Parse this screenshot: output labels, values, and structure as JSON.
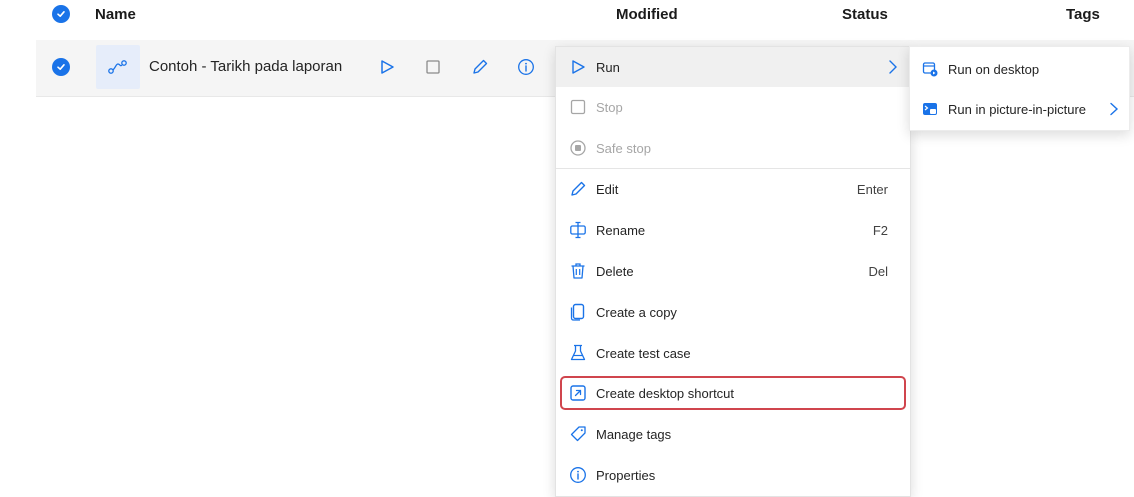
{
  "header": {
    "name": "Name",
    "modified": "Modified",
    "status": "Status",
    "tags": "Tags"
  },
  "row": {
    "name": "Contoh - Tarikh pada laporan"
  },
  "menu": {
    "items": [
      {
        "label": "Run",
        "shortcut": ""
      },
      {
        "label": "Stop",
        "shortcut": ""
      },
      {
        "label": "Safe stop",
        "shortcut": ""
      },
      {
        "label": "Edit",
        "shortcut": "Enter"
      },
      {
        "label": "Rename",
        "shortcut": "F2"
      },
      {
        "label": "Delete",
        "shortcut": "Del"
      },
      {
        "label": "Create a copy",
        "shortcut": ""
      },
      {
        "label": "Create test case",
        "shortcut": ""
      },
      {
        "label": "Create desktop shortcut",
        "shortcut": ""
      },
      {
        "label": "Manage tags",
        "shortcut": ""
      },
      {
        "label": "Properties",
        "shortcut": ""
      }
    ]
  },
  "submenu": {
    "items": [
      {
        "label": "Run on desktop"
      },
      {
        "label": "Run in picture-in-picture"
      }
    ]
  },
  "colors": {
    "accent": "#1a73e8",
    "highlight_border": "#d0454d",
    "disabled_text": "#a6a6a6"
  }
}
